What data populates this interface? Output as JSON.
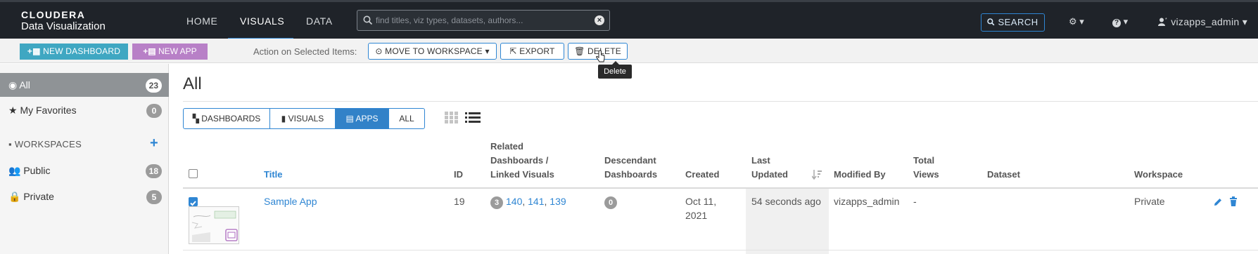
{
  "brand": {
    "line1": "CLOUDERA",
    "line2": "Data Visualization"
  },
  "nav": {
    "home": "HOME",
    "visuals": "VISUALS",
    "data": "DATA",
    "search_placeholder": "find titles, viz types, datasets, authors...",
    "search_button": "SEARCH",
    "user": "vizapps_admin"
  },
  "actions": {
    "new_dashboard": "NEW DASHBOARD",
    "new_app": "NEW APP",
    "label": "Action on Selected Items:",
    "move": "MOVE TO WORKSPACE",
    "export": "EXPORT",
    "delete": "DELETE",
    "tooltip": "Delete"
  },
  "sidebar": {
    "all": {
      "label": "All",
      "count": "23"
    },
    "favorites": {
      "label": "My Favorites",
      "count": "0"
    },
    "workspaces_heading": "WORKSPACES",
    "public": {
      "label": "Public",
      "count": "18"
    },
    "private": {
      "label": "Private",
      "count": "5"
    }
  },
  "main": {
    "title": "All",
    "filters": [
      "DASHBOARDS",
      "VISUALS",
      "APPS",
      "ALL"
    ],
    "active_filter": "APPS"
  },
  "table": {
    "headers": {
      "title": "Title",
      "id": "ID",
      "related_1": "Related",
      "related_2": "Dashboards /",
      "related_3": "Linked Visuals",
      "desc_1": "Descendant",
      "desc_2": "Dashboards",
      "created": "Created",
      "updated_1": "Last",
      "updated_2": "Updated",
      "modified_by": "Modified By",
      "views_1": "Total",
      "views_2": "Views",
      "dataset": "Dataset",
      "workspace": "Workspace"
    },
    "rows": [
      {
        "title": "Sample App",
        "id": "19",
        "related_count": "3",
        "related_links": [
          "140",
          "141",
          "139"
        ],
        "sep": ", ",
        "descendant_count": "0",
        "created_1": "Oct 11,",
        "created_2": "2021",
        "updated": "54 seconds ago",
        "modified_by": "vizapps_admin",
        "views": "-",
        "dataset": "",
        "workspace": "Private",
        "selected": true
      }
    ]
  },
  "colors": {
    "accent": "#2f86d3",
    "teal": "#3fa7c2",
    "purple": "#b880c7",
    "nav_bg": "#1f2329"
  }
}
